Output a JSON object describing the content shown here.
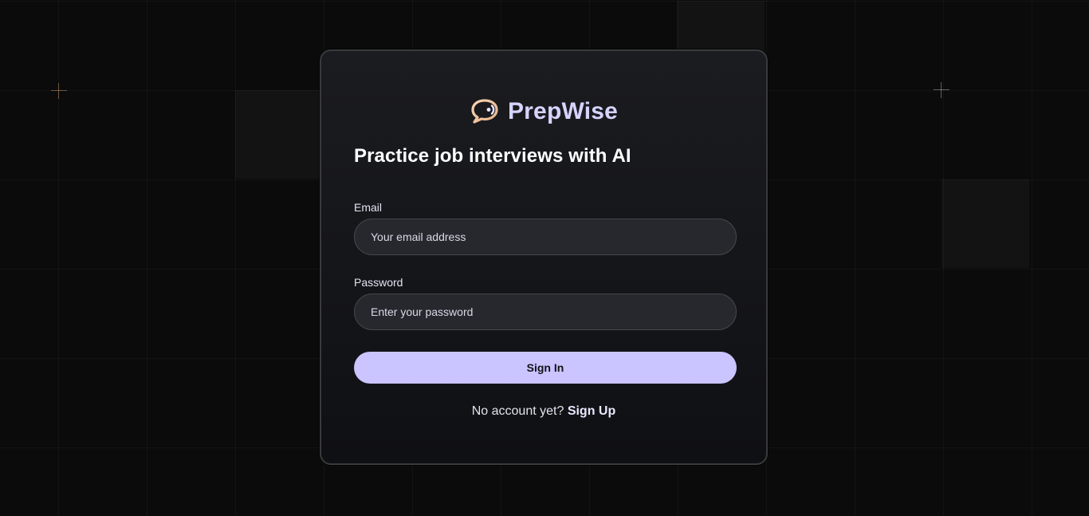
{
  "brand": {
    "name": "PrepWise",
    "logo_icon": "chat-bubble-icon"
  },
  "headline": "Practice job interviews with AI",
  "form": {
    "email": {
      "label": "Email",
      "placeholder": "Your email address",
      "value": ""
    },
    "password": {
      "label": "Password",
      "placeholder": "Enter your password",
      "value": ""
    },
    "submit_label": "Sign In"
  },
  "footer": {
    "prompt": "No account yet?",
    "link_label": "Sign Up"
  },
  "colors": {
    "accent": "#cac4ff",
    "brand_text": "#d6d4ff",
    "background": "#0b0b0c",
    "card": "#1b1c20"
  }
}
